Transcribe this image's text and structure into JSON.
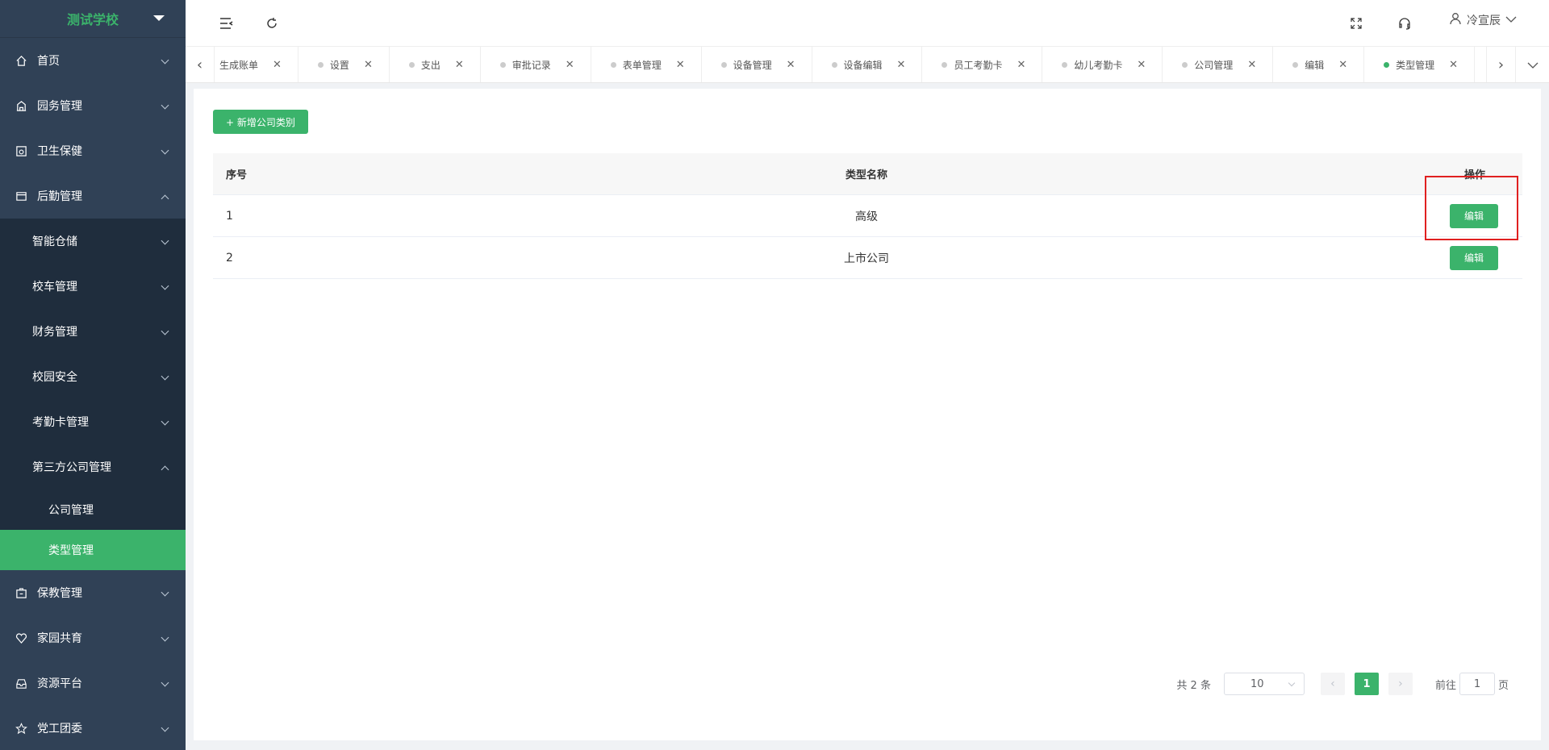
{
  "brand": {
    "title": "测试学校"
  },
  "sidebar": {
    "items": [
      {
        "label": "首页",
        "icon": "home-icon"
      },
      {
        "label": "园务管理",
        "icon": "building-icon"
      },
      {
        "label": "卫生保健",
        "icon": "health-icon"
      },
      {
        "label": "后勤管理",
        "icon": "logistics-icon"
      }
    ],
    "logistics_sub": [
      {
        "label": "智能仓储"
      },
      {
        "label": "校车管理"
      },
      {
        "label": "财务管理"
      },
      {
        "label": "校园安全"
      },
      {
        "label": "考勤卡管理"
      },
      {
        "label": "第三方公司管理"
      }
    ],
    "third_party_sub": [
      {
        "label": "公司管理"
      },
      {
        "label": "类型管理"
      }
    ],
    "bottom_items": [
      {
        "label": "保教管理",
        "icon": "education-icon"
      },
      {
        "label": "家园共育",
        "icon": "heart-icon"
      },
      {
        "label": "资源平台",
        "icon": "inbox-icon"
      },
      {
        "label": "党工团委",
        "icon": "star-icon"
      }
    ]
  },
  "header": {
    "user_name": "冷宣辰"
  },
  "tabs": [
    {
      "label": "生成账单"
    },
    {
      "label": "设置"
    },
    {
      "label": "支出"
    },
    {
      "label": "审批记录"
    },
    {
      "label": "表单管理"
    },
    {
      "label": "设备管理"
    },
    {
      "label": "设备编辑"
    },
    {
      "label": "员工考勤卡"
    },
    {
      "label": "幼儿考勤卡"
    },
    {
      "label": "公司管理"
    },
    {
      "label": "编辑"
    },
    {
      "label": "类型管理"
    }
  ],
  "main": {
    "add_button": "+ 新增公司类别",
    "columns": [
      "序号",
      "类型名称",
      "操作"
    ],
    "rows": [
      {
        "index": "1",
        "name": "高级",
        "action": "编辑"
      },
      {
        "index": "2",
        "name": "上市公司",
        "action": "编辑"
      }
    ]
  },
  "pagination": {
    "total": "共 2 条",
    "page_size": "10",
    "current": "1",
    "goto_prefix": "前往",
    "goto_value": "1",
    "goto_suffix": "页"
  },
  "colors": {
    "accent": "#3bb36b",
    "sidebar_bg": "#304156",
    "highlight": "#e02020"
  }
}
